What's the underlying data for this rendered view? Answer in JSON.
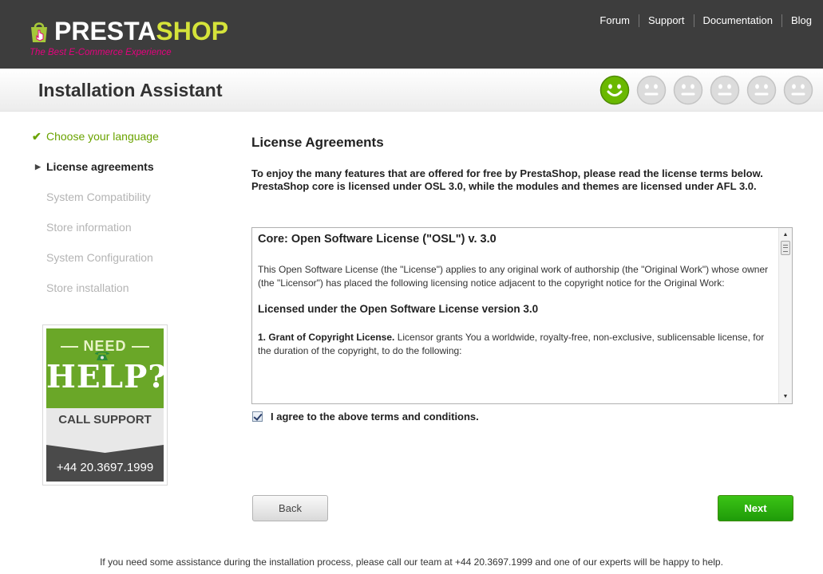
{
  "header": {
    "logo_white": "PRESTA",
    "logo_color": "SHOP",
    "tagline": "The Best E-Commerce Experience",
    "nav": [
      "Forum",
      "Support",
      "Documentation",
      "Blog"
    ]
  },
  "title": "Installation Assistant",
  "progress": {
    "completed": 1,
    "total": 6
  },
  "steps": [
    {
      "label": "Choose your language",
      "state": "done"
    },
    {
      "label": "License agreements",
      "state": "active"
    },
    {
      "label": "System Compatibility",
      "state": "pending"
    },
    {
      "label": "Store information",
      "state": "pending"
    },
    {
      "label": "System Configuration",
      "state": "pending"
    },
    {
      "label": "Store installation",
      "state": "pending"
    }
  ],
  "help": {
    "need": "NEED",
    "help": "HELP?",
    "call": "CALL SUPPORT",
    "phone": "+44 20.3697.1999"
  },
  "main": {
    "title": "License Agreements",
    "intro": "To enjoy the many features that are offered for free by PrestaShop, please read the license terms below. PrestaShop core is licensed under OSL 3.0, while the modules and themes are licensed under AFL 3.0.",
    "license": {
      "heading": "Core: Open Software License (\"OSL\") v. 3.0",
      "para1": "This Open Software License (the \"License\") applies to any original work of authorship (the \"Original Work\") whose owner (the \"Licensor\") has placed the following licensing notice adjacent to the copyright notice for the Original Work:",
      "subheading": "Licensed under the Open Software License version 3.0",
      "grant_title": "1. Grant of Copyright License.",
      "grant_text": " Licensor grants You a worldwide, royalty-free, non-exclusive, sublicensable license, for the duration of the copyright, to do the following:"
    },
    "agree_label": "I agree to the above terms and conditions.",
    "agree_checked": true,
    "back_label": "Back",
    "next_label": "Next"
  },
  "footer": "If you need some assistance during the installation process, please call our team at +44 20.3697.1999 and one of our experts will be happy to help.",
  "colors": {
    "header_bg": "#3d3d3d",
    "accent_green": "#6aa300",
    "logo_accent": "#d5e33a",
    "tagline": "#e6007e",
    "next_button": "#1f9b09"
  }
}
